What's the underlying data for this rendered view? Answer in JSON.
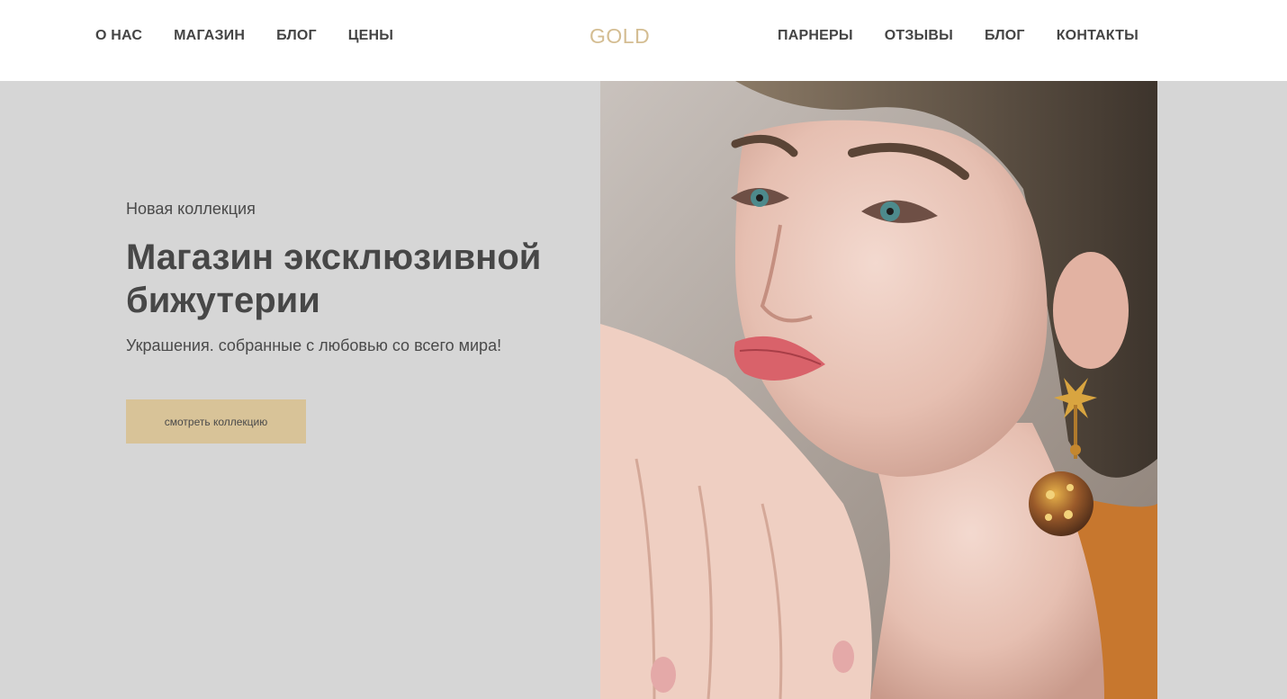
{
  "header": {
    "logo": "GOLD",
    "nav_left": [
      "О НАС",
      "МАГАЗИН",
      "БЛОГ",
      "ЦЕНЫ"
    ],
    "nav_right": [
      "ПАРНЕРЫ",
      "ОТЗЫВЫ",
      "БЛОГ",
      "КОНТАКТЫ"
    ]
  },
  "hero": {
    "eyebrow": "Новая коллекция",
    "headline": "Магазин эксклюзивной бижутерии",
    "subtitle": "Украшения. собранные с любовью со всего мира!",
    "cta_label": "смотреть коллекцию"
  },
  "colors": {
    "accent": "#d8c398",
    "logo": "#d4bd92",
    "hero_background": "#d6d6d6",
    "text": "#444444"
  }
}
